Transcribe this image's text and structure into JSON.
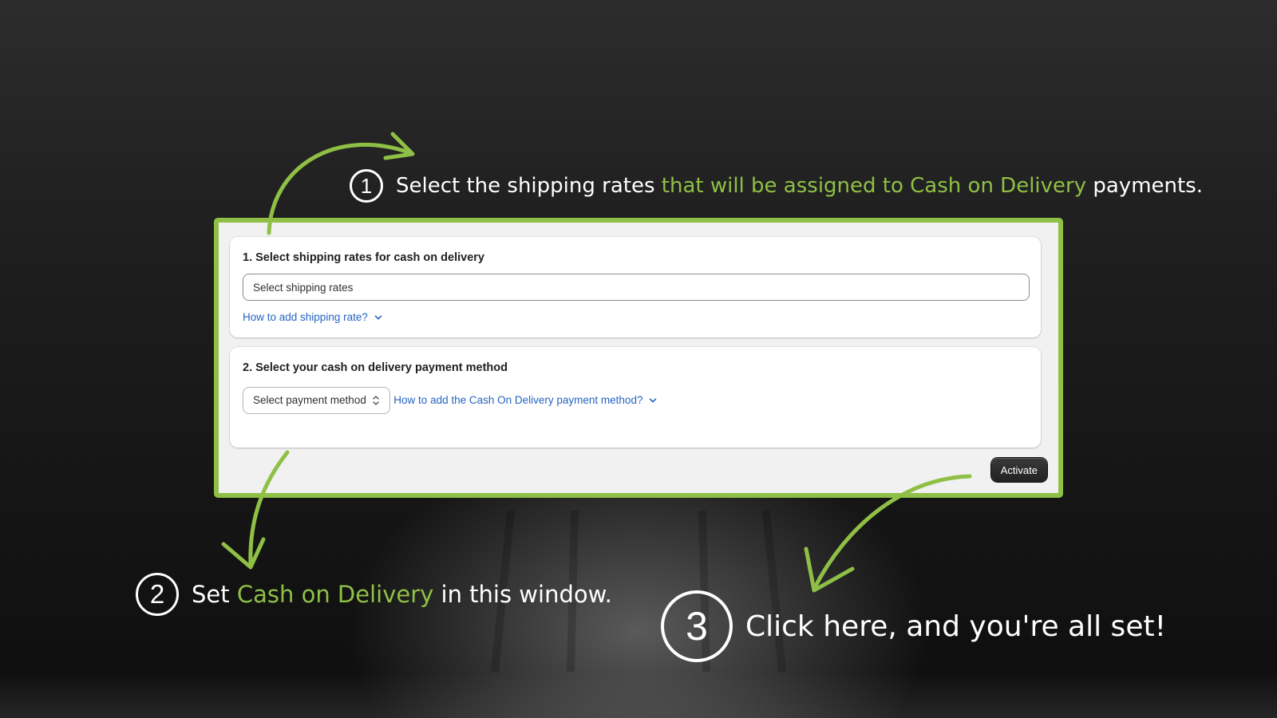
{
  "steps": {
    "step1": {
      "number": "1",
      "text_before": "Select the shipping rates ",
      "text_highlight": "that will be assigned to Cash on Delivery",
      "text_after": " payments."
    },
    "step2": {
      "number": "2",
      "text_before": "Set ",
      "text_highlight": "Cash on Delivery",
      "text_after": " in this window."
    },
    "step3": {
      "number": "3",
      "text": "Click here, and you're all set!"
    }
  },
  "panel": {
    "shipping": {
      "title": "1. Select shipping rates for cash on delivery",
      "placeholder": "Select shipping rates",
      "help_link": "How to add shipping rate?"
    },
    "payment": {
      "title": "2. Select your cash on delivery payment method",
      "select_value": "Select payment method",
      "help_link": "How to add the Cash On Delivery payment method?"
    },
    "activate_label": "Activate"
  },
  "colors": {
    "accent": "#8fc045",
    "link": "#2463c4",
    "button": "#222222"
  },
  "icons": {
    "help_chevron": "chevron-down-icon",
    "select_chevron": "select-updown-icon"
  }
}
